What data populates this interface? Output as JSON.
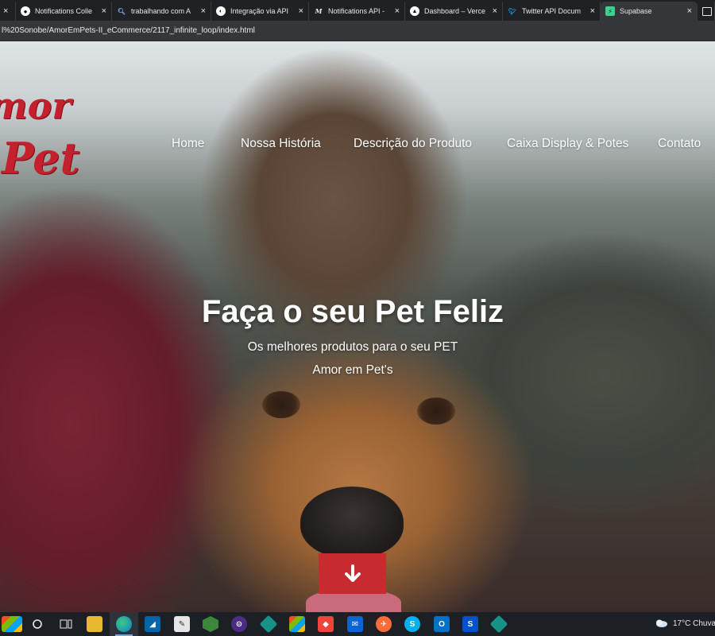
{
  "browser": {
    "tabs": [
      {
        "title": "",
        "favicon": "page-icon",
        "active": false
      },
      {
        "title": "Notifications Colle",
        "favicon": "github-icon",
        "active": false
      },
      {
        "title": "trabalhando com A",
        "favicon": "search-icon",
        "active": false
      },
      {
        "title": "Integração via API",
        "favicon": "vercel-icon",
        "active": false
      },
      {
        "title": "Notifications API -",
        "favicon": "medium-icon",
        "active": false
      },
      {
        "title": "Dashboard – Verce",
        "favicon": "vercel-triangle-icon",
        "active": false
      },
      {
        "title": "Twitter API Docum",
        "favicon": "twitter-icon",
        "active": false
      },
      {
        "title": "Supabase",
        "favicon": "supabase-icon",
        "active": true
      }
    ],
    "url": "l%20Sonobe/AmorEmPets-II_eCommerce/2117_infinite_loop/index.html"
  },
  "site": {
    "logo": {
      "line1": "mor",
      "line2": "Pet's"
    },
    "nav": [
      "Home",
      "Nossa História",
      "Descrição do Produto",
      "Caixa Display & Potes",
      "Contato"
    ],
    "hero": {
      "title": "Faça o seu Pet Feliz",
      "subtitle": "Os melhores produtos para o seu PET",
      "brand": "Amor em Pet's"
    },
    "scroll_button_icon": "arrow-down-icon",
    "accent_color": "#c72a2f"
  },
  "taskbar": {
    "apps": [
      "windows-start-icon",
      "search-circle-icon",
      "task-view-icon",
      "file-explorer-icon",
      "edge-icon",
      "vscode-icon",
      "notepad-icon",
      "nodejs-icon",
      "insomnia-icon",
      "gitkraken-icon",
      "store-icon",
      "anydesk-icon",
      "mail-icon",
      "postman-icon",
      "skype-icon",
      "outlook-icon",
      "sourcetree-icon",
      "git-icon"
    ],
    "weather": "17°C  Chuva"
  }
}
